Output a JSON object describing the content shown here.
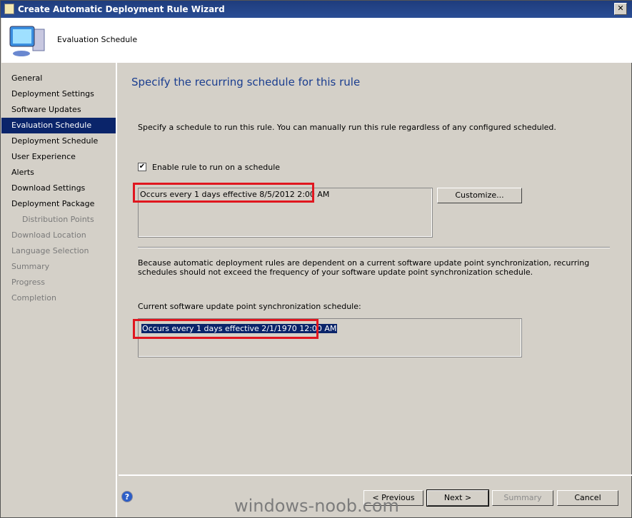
{
  "window": {
    "title": "Create Automatic Deployment Rule Wizard",
    "close": "✕"
  },
  "header": {
    "title": "Evaluation Schedule"
  },
  "sidebar": {
    "items": [
      {
        "label": "General",
        "state": "normal"
      },
      {
        "label": "Deployment Settings",
        "state": "normal"
      },
      {
        "label": "Software Updates",
        "state": "normal"
      },
      {
        "label": "Evaluation Schedule",
        "state": "active"
      },
      {
        "label": "Deployment Schedule",
        "state": "normal"
      },
      {
        "label": "User Experience",
        "state": "normal"
      },
      {
        "label": "Alerts",
        "state": "normal"
      },
      {
        "label": "Download Settings",
        "state": "normal"
      },
      {
        "label": "Deployment Package",
        "state": "normal"
      },
      {
        "label": "Distribution Points",
        "state": "disabled"
      },
      {
        "label": "Download Location",
        "state": "disabled"
      },
      {
        "label": "Language Selection",
        "state": "disabled"
      },
      {
        "label": "Summary",
        "state": "disabled"
      },
      {
        "label": "Progress",
        "state": "disabled"
      },
      {
        "label": "Completion",
        "state": "disabled"
      }
    ]
  },
  "main": {
    "heading": "Specify the recurring schedule for this rule",
    "description": "Specify a schedule to run this rule. You can manually run this rule regardless of any configured scheduled.",
    "enable_label": "Enable rule to run on a schedule",
    "enable_checked": true,
    "schedule": "Occurs every 1 days effective 8/5/2012 2:00 AM",
    "customize": "Customize...",
    "note": "Because automatic deployment rules are dependent on a current software update point synchronization, recurring schedules should not exceed the frequency of your software update point synchronization schedule.",
    "sync_label": "Current software update point synchronization schedule:",
    "sync_schedule": "Occurs every 1 days effective 2/1/1970 12:00 AM"
  },
  "footer": {
    "previous": "< Previous",
    "next": "Next >",
    "summary": "Summary",
    "cancel": "Cancel",
    "help": "?"
  },
  "watermark": "windows-noob.com"
}
